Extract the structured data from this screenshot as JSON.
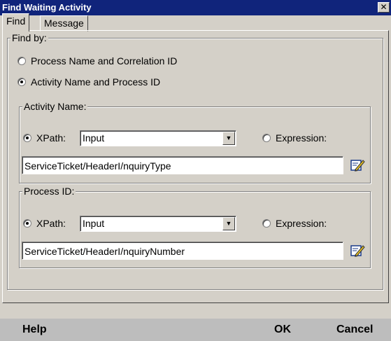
{
  "window": {
    "title": "Find Waiting Activity",
    "close_label": "✕"
  },
  "tabs": [
    {
      "label": "Find",
      "active": true
    },
    {
      "label": "Message",
      "active": false
    }
  ],
  "find_by": {
    "legend": "Find by:",
    "options": [
      {
        "label": "Process Name and Correlation ID",
        "selected": false
      },
      {
        "label": "Activity Name and Process ID",
        "selected": true
      }
    ]
  },
  "activity_name": {
    "legend": "Activity Name:",
    "xpath_label": "XPath:",
    "xpath_selected": true,
    "combo_value": "Input",
    "expression_label": "Expression:",
    "expression_selected": false,
    "field_value": "ServiceTicket/HeaderI/nquiryType",
    "edit_icon": "edit-pencil-icon"
  },
  "process_id": {
    "legend": "Process ID:",
    "xpath_label": "XPath:",
    "xpath_selected": true,
    "combo_value": "Input",
    "expression_label": "Expression:",
    "expression_selected": false,
    "field_value": "ServiceTicket/HeaderI/nquiryNumber",
    "edit_icon": "edit-pencil-icon"
  },
  "footer": {
    "help_label": "Help",
    "ok_label": "OK",
    "cancel_label": "Cancel"
  },
  "colors": {
    "titlebar": "#10247b",
    "dialog_bg": "#d4d0c8",
    "footer_bg": "#bdbdbd"
  }
}
